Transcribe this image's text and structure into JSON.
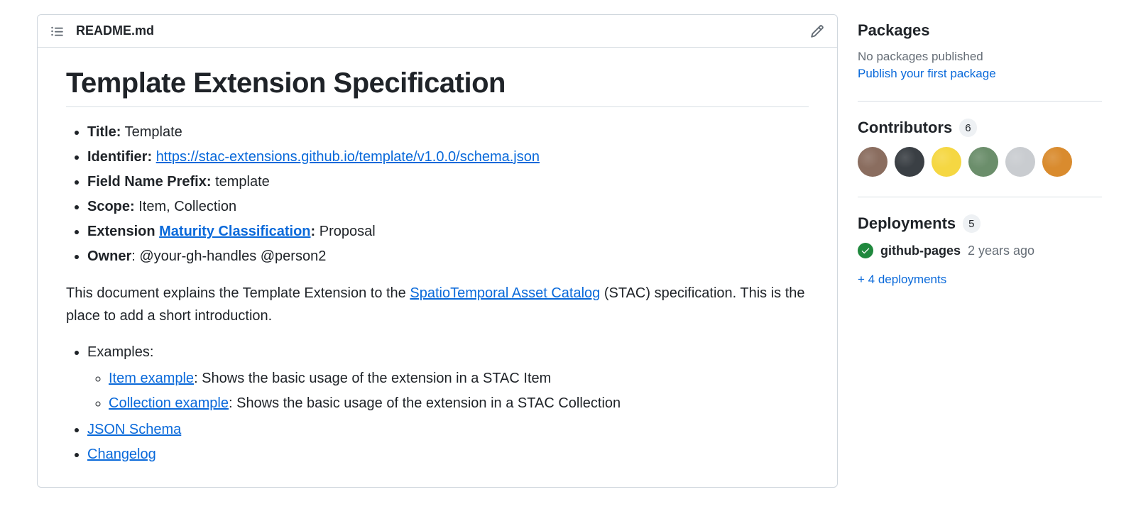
{
  "readme": {
    "filename": "README.md",
    "heading": "Template Extension Specification",
    "meta": {
      "title_label": "Title:",
      "title_value": " Template",
      "identifier_label": "Identifier:",
      "identifier_link": "https://stac-extensions.github.io/template/v1.0.0/schema.json",
      "prefix_label": "Field Name Prefix:",
      "prefix_value": " template",
      "scope_label": "Scope:",
      "scope_value": " Item, Collection",
      "ext_label_pre": "Extension ",
      "maturity_link": "Maturity Classification",
      "ext_label_post": ":",
      "maturity_value": " Proposal",
      "owner_label": "Owner",
      "owner_value": ": @your-gh-handles @person2"
    },
    "intro_pre": "This document explains the Template Extension to the ",
    "intro_link": "SpatioTemporal Asset Catalog",
    "intro_post": " (STAC) specification. This is the place to add a short introduction.",
    "links": {
      "examples_label": "Examples:",
      "item_example_link": "Item example",
      "item_example_desc": ": Shows the basic usage of the extension in a STAC Item",
      "collection_example_link": "Collection example",
      "collection_example_desc": ": Shows the basic usage of the extension in a STAC Collection",
      "json_schema": "JSON Schema",
      "changelog": "Changelog"
    }
  },
  "sidebar": {
    "packages": {
      "heading": "Packages",
      "none_text": "No packages published",
      "publish_link": "Publish your first package"
    },
    "contributors": {
      "heading": "Contributors",
      "count": "6",
      "avatar_colors": [
        "#8a6d5f",
        "#3a3f44",
        "#f5d742",
        "#6b8e6b",
        "#c9ccd0",
        "#d98b2e"
      ]
    },
    "deployments": {
      "heading": "Deployments",
      "count": "5",
      "env_name": "github-pages",
      "env_time": "2 years ago",
      "more_link": "+ 4 deployments"
    }
  }
}
